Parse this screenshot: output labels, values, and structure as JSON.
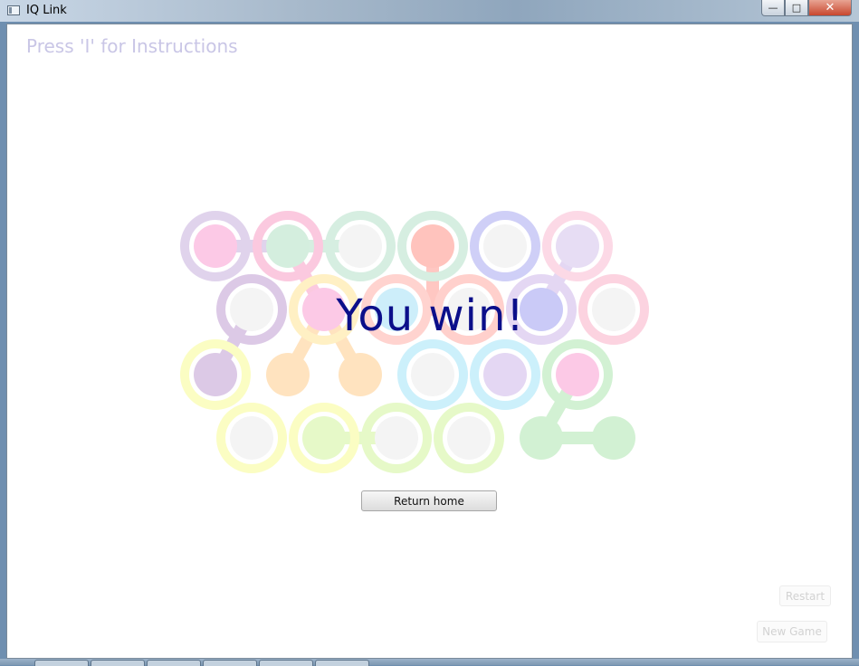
{
  "window": {
    "title": "IQ Link"
  },
  "instructions": "Press 'I' for Instructions",
  "message": "You win!",
  "buttons": {
    "return_home": "Return home",
    "restart": "Restart",
    "new_game": "New Game"
  },
  "colors": {
    "message": "#0b0f8a",
    "instructions": "#c9c6e6",
    "peg_empty": "#f4f4f4"
  },
  "board": {
    "rows": 4,
    "cols": 6,
    "state": "solved",
    "pieces": [
      "purple",
      "pink",
      "mint",
      "salmon",
      "blue",
      "light-pink",
      "lavender",
      "yellow",
      "orange",
      "light-blue",
      "green",
      "lime"
    ]
  }
}
